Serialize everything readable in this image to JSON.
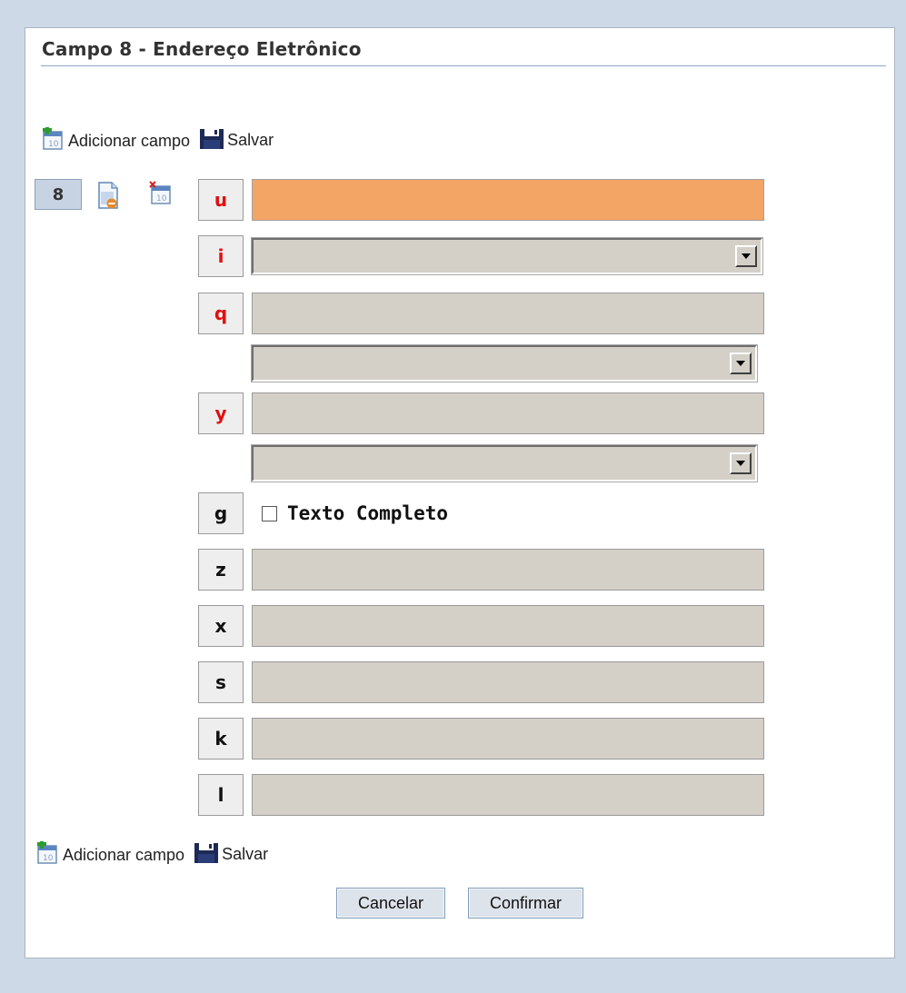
{
  "header": {
    "title": "Campo 8 - Endereço Eletrônico"
  },
  "toolbar": {
    "add_label": "Adicionar campo",
    "save_label": "Salvar"
  },
  "field": {
    "tag": "8"
  },
  "subfields": [
    {
      "code": "u",
      "required": true,
      "control": "text",
      "value": ""
    },
    {
      "code": "i",
      "required": true,
      "control": "select",
      "value": ""
    },
    {
      "code": "q",
      "required": true,
      "control": "text+select",
      "value": ""
    },
    {
      "code": "y",
      "required": true,
      "control": "text+select",
      "value": ""
    },
    {
      "code": "g",
      "required": false,
      "control": "checkbox",
      "checkbox_label": "Texto Completo"
    },
    {
      "code": "z",
      "required": false,
      "control": "text",
      "value": ""
    },
    {
      "code": "x",
      "required": false,
      "control": "text",
      "value": ""
    },
    {
      "code": "s",
      "required": false,
      "control": "text",
      "value": ""
    },
    {
      "code": "k",
      "required": false,
      "control": "text",
      "value": ""
    },
    {
      "code": "l",
      "required": false,
      "control": "text",
      "value": ""
    }
  ],
  "actions": {
    "cancel_label": "Cancelar",
    "confirm_label": "Confirmar"
  },
  "colors": {
    "required_code": "#e01010",
    "active_input": "#f3a566",
    "input_bg": "#d4d0c8",
    "page_bg": "#cdd9e6"
  }
}
